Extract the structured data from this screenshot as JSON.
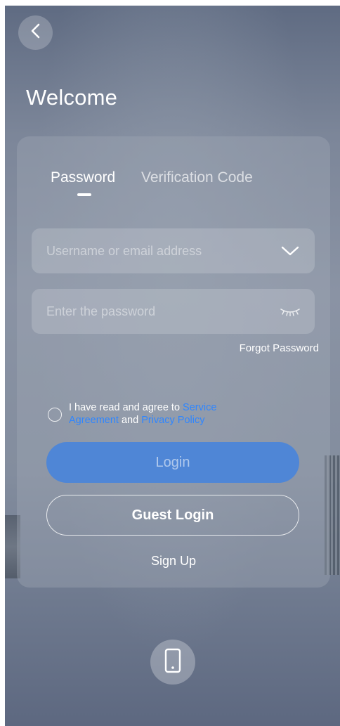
{
  "header": {
    "back_icon": "chevron-left-icon",
    "title": "Welcome"
  },
  "tabs": [
    {
      "label": "Password",
      "active": true
    },
    {
      "label": "Verification Code",
      "active": false
    }
  ],
  "form": {
    "username_placeholder": "Username or email address",
    "username_value": "",
    "username_icon": "chevron-down-icon",
    "password_placeholder": "Enter the password",
    "password_value": "",
    "password_icon": "eye-closed-icon",
    "forgot_label": "Forgot Password"
  },
  "agreement": {
    "checked": false,
    "prefix": "I have read and agree to",
    "service_link": "Service Agreement",
    "conjunction": "and",
    "privacy_link": "Privacy Policy",
    "link_color": "#2f86ff"
  },
  "buttons": {
    "login_label": "Login",
    "guest_label": "Guest Login",
    "signup_label": "Sign Up"
  },
  "footer": {
    "phone_icon": "mobile-phone-icon"
  },
  "colors": {
    "accent": "#4f86d6",
    "link": "#2f86ff"
  }
}
